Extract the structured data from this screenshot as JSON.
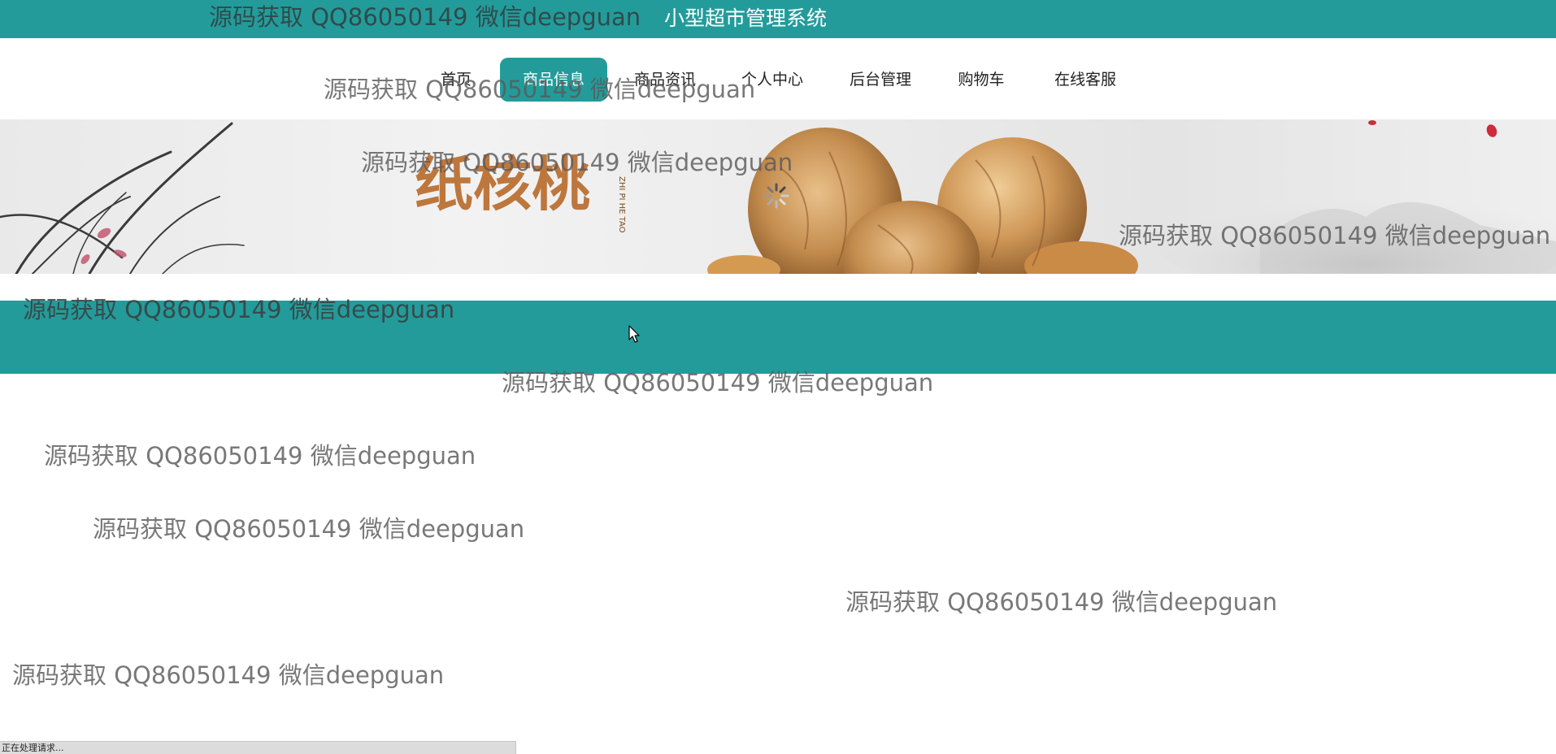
{
  "header": {
    "site_title": "小型超市管理系统"
  },
  "nav": {
    "items": [
      {
        "label": "首页"
      },
      {
        "label": "商品信息",
        "active": true
      },
      {
        "label": "商品资讯"
      },
      {
        "label": "个人中心"
      },
      {
        "label": "后台管理"
      },
      {
        "label": "购物车"
      },
      {
        "label": "在线客服"
      }
    ]
  },
  "banner": {
    "calligraphy_text": "纸核桃",
    "pinyin": "ZHI PI HE TAO"
  },
  "watermark": {
    "text": "源码获取 QQ86050149 微信deepguan"
  },
  "status": {
    "text": "正在处理请求..."
  },
  "colors": {
    "primary": "#249b9b",
    "nav_active_text": "#ffffff",
    "nav_text": "#222222"
  },
  "icons": {
    "cursor": "mouse-pointer-icon",
    "loading": "loading-spinner-icon"
  }
}
